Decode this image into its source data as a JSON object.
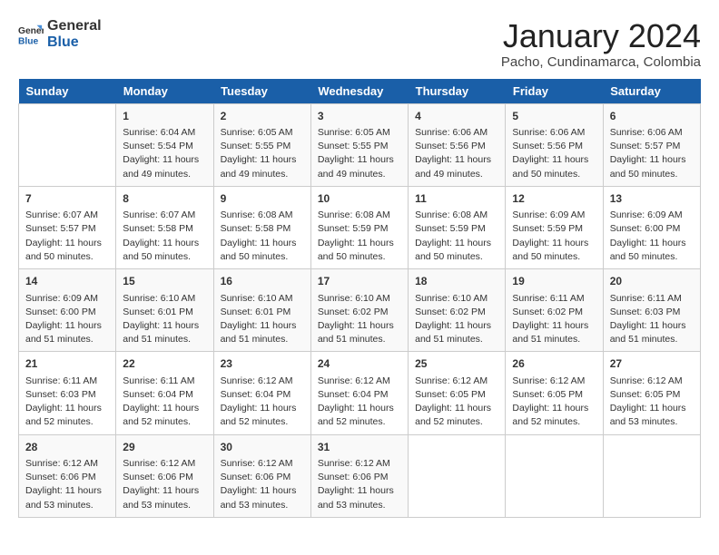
{
  "header": {
    "logo_line1": "General",
    "logo_line2": "Blue",
    "main_title": "January 2024",
    "subtitle": "Pacho, Cundinamarca, Colombia"
  },
  "days_of_week": [
    "Sunday",
    "Monday",
    "Tuesday",
    "Wednesday",
    "Thursday",
    "Friday",
    "Saturday"
  ],
  "weeks": [
    [
      {
        "day": "",
        "info": ""
      },
      {
        "day": "1",
        "info": "Sunrise: 6:04 AM\nSunset: 5:54 PM\nDaylight: 11 hours\nand 49 minutes."
      },
      {
        "day": "2",
        "info": "Sunrise: 6:05 AM\nSunset: 5:55 PM\nDaylight: 11 hours\nand 49 minutes."
      },
      {
        "day": "3",
        "info": "Sunrise: 6:05 AM\nSunset: 5:55 PM\nDaylight: 11 hours\nand 49 minutes."
      },
      {
        "day": "4",
        "info": "Sunrise: 6:06 AM\nSunset: 5:56 PM\nDaylight: 11 hours\nand 49 minutes."
      },
      {
        "day": "5",
        "info": "Sunrise: 6:06 AM\nSunset: 5:56 PM\nDaylight: 11 hours\nand 50 minutes."
      },
      {
        "day": "6",
        "info": "Sunrise: 6:06 AM\nSunset: 5:57 PM\nDaylight: 11 hours\nand 50 minutes."
      }
    ],
    [
      {
        "day": "7",
        "info": "Sunrise: 6:07 AM\nSunset: 5:57 PM\nDaylight: 11 hours\nand 50 minutes."
      },
      {
        "day": "8",
        "info": "Sunrise: 6:07 AM\nSunset: 5:58 PM\nDaylight: 11 hours\nand 50 minutes."
      },
      {
        "day": "9",
        "info": "Sunrise: 6:08 AM\nSunset: 5:58 PM\nDaylight: 11 hours\nand 50 minutes."
      },
      {
        "day": "10",
        "info": "Sunrise: 6:08 AM\nSunset: 5:59 PM\nDaylight: 11 hours\nand 50 minutes."
      },
      {
        "day": "11",
        "info": "Sunrise: 6:08 AM\nSunset: 5:59 PM\nDaylight: 11 hours\nand 50 minutes."
      },
      {
        "day": "12",
        "info": "Sunrise: 6:09 AM\nSunset: 5:59 PM\nDaylight: 11 hours\nand 50 minutes."
      },
      {
        "day": "13",
        "info": "Sunrise: 6:09 AM\nSunset: 6:00 PM\nDaylight: 11 hours\nand 50 minutes."
      }
    ],
    [
      {
        "day": "14",
        "info": "Sunrise: 6:09 AM\nSunset: 6:00 PM\nDaylight: 11 hours\nand 51 minutes."
      },
      {
        "day": "15",
        "info": "Sunrise: 6:10 AM\nSunset: 6:01 PM\nDaylight: 11 hours\nand 51 minutes."
      },
      {
        "day": "16",
        "info": "Sunrise: 6:10 AM\nSunset: 6:01 PM\nDaylight: 11 hours\nand 51 minutes."
      },
      {
        "day": "17",
        "info": "Sunrise: 6:10 AM\nSunset: 6:02 PM\nDaylight: 11 hours\nand 51 minutes."
      },
      {
        "day": "18",
        "info": "Sunrise: 6:10 AM\nSunset: 6:02 PM\nDaylight: 11 hours\nand 51 minutes."
      },
      {
        "day": "19",
        "info": "Sunrise: 6:11 AM\nSunset: 6:02 PM\nDaylight: 11 hours\nand 51 minutes."
      },
      {
        "day": "20",
        "info": "Sunrise: 6:11 AM\nSunset: 6:03 PM\nDaylight: 11 hours\nand 51 minutes."
      }
    ],
    [
      {
        "day": "21",
        "info": "Sunrise: 6:11 AM\nSunset: 6:03 PM\nDaylight: 11 hours\nand 52 minutes."
      },
      {
        "day": "22",
        "info": "Sunrise: 6:11 AM\nSunset: 6:04 PM\nDaylight: 11 hours\nand 52 minutes."
      },
      {
        "day": "23",
        "info": "Sunrise: 6:12 AM\nSunset: 6:04 PM\nDaylight: 11 hours\nand 52 minutes."
      },
      {
        "day": "24",
        "info": "Sunrise: 6:12 AM\nSunset: 6:04 PM\nDaylight: 11 hours\nand 52 minutes."
      },
      {
        "day": "25",
        "info": "Sunrise: 6:12 AM\nSunset: 6:05 PM\nDaylight: 11 hours\nand 52 minutes."
      },
      {
        "day": "26",
        "info": "Sunrise: 6:12 AM\nSunset: 6:05 PM\nDaylight: 11 hours\nand 52 minutes."
      },
      {
        "day": "27",
        "info": "Sunrise: 6:12 AM\nSunset: 6:05 PM\nDaylight: 11 hours\nand 53 minutes."
      }
    ],
    [
      {
        "day": "28",
        "info": "Sunrise: 6:12 AM\nSunset: 6:06 PM\nDaylight: 11 hours\nand 53 minutes."
      },
      {
        "day": "29",
        "info": "Sunrise: 6:12 AM\nSunset: 6:06 PM\nDaylight: 11 hours\nand 53 minutes."
      },
      {
        "day": "30",
        "info": "Sunrise: 6:12 AM\nSunset: 6:06 PM\nDaylight: 11 hours\nand 53 minutes."
      },
      {
        "day": "31",
        "info": "Sunrise: 6:12 AM\nSunset: 6:06 PM\nDaylight: 11 hours\nand 53 minutes."
      },
      {
        "day": "",
        "info": ""
      },
      {
        "day": "",
        "info": ""
      },
      {
        "day": "",
        "info": ""
      }
    ]
  ]
}
